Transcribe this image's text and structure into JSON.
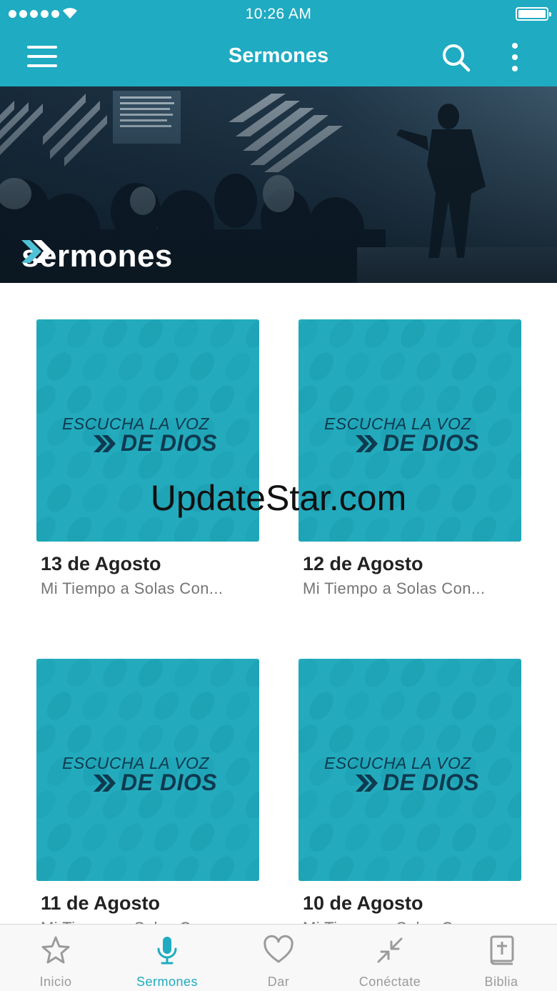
{
  "status_bar": {
    "time": "10:26 AM"
  },
  "nav": {
    "title": "Sermones"
  },
  "banner": {
    "label": "sermones"
  },
  "sermons": [
    {
      "date": "13 de Agosto",
      "subtitle": "Mi Tiempo a Solas Con...",
      "art_line1": "ESCUCHA LA VOZ",
      "art_line2": "DE DIOS"
    },
    {
      "date": "12 de Agosto",
      "subtitle": "Mi Tiempo a Solas Con...",
      "art_line1": "ESCUCHA LA VOZ",
      "art_line2": "DE DIOS"
    },
    {
      "date": "11 de Agosto",
      "subtitle": "Mi Tiempo a Solas Con...",
      "art_line1": "ESCUCHA LA VOZ",
      "art_line2": "DE DIOS"
    },
    {
      "date": "10 de Agosto",
      "subtitle": "Mi Tiempo a Solas Con...",
      "art_line1": "ESCUCHA LA VOZ",
      "art_line2": "DE DIOS"
    }
  ],
  "watermark": "UpdateStar.com",
  "tabs": [
    {
      "label": "Inicio",
      "icon": "star-icon",
      "active": false
    },
    {
      "label": "Sermones",
      "icon": "microphone-icon",
      "active": true
    },
    {
      "label": "Dar",
      "icon": "heart-icon",
      "active": false
    },
    {
      "label": "Conéctate",
      "icon": "connect-arrows-icon",
      "active": false
    },
    {
      "label": "Biblia",
      "icon": "bible-icon",
      "active": false
    }
  ],
  "colors": {
    "accent": "#1fabc2",
    "card": "#23abbd",
    "art_text": "#0f3a4f",
    "tab_inactive": "#9b9b9b"
  }
}
